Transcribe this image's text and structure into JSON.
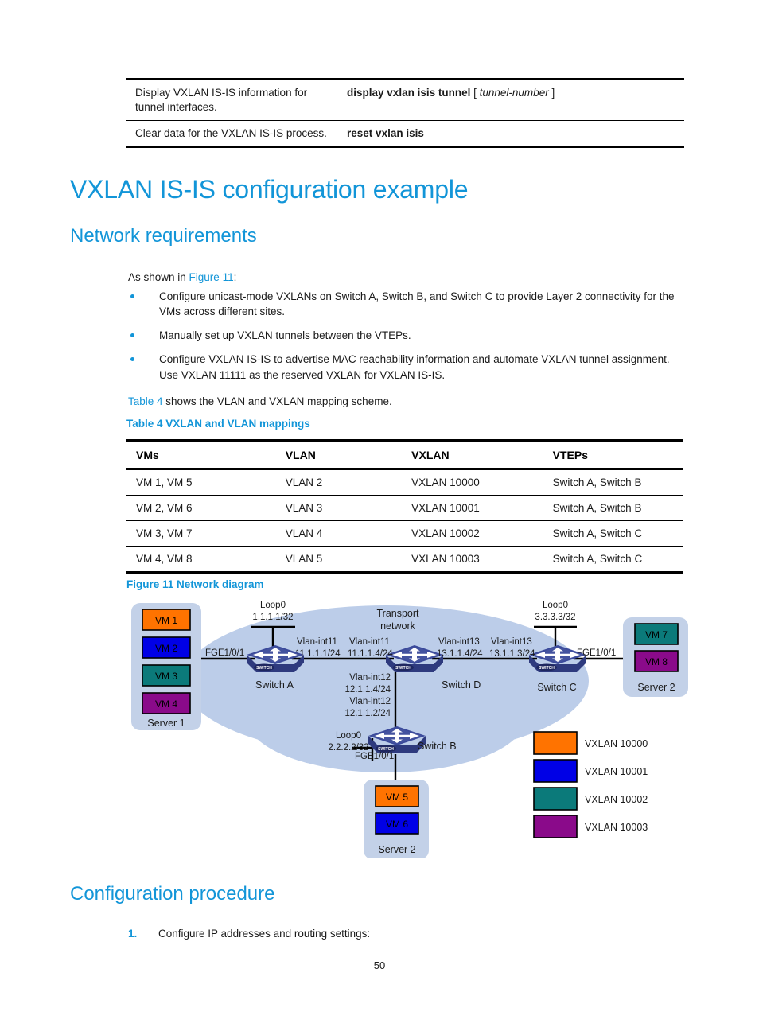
{
  "colors": {
    "heading_blue": "#1295D8",
    "link_blue": "#1295D8",
    "cloud_fill": "#BCCDE9",
    "server_fill": "#C3D1E8",
    "switch_body": "#3B4A9B",
    "switch_top": "#5A6BBF",
    "switch_side": "#2E3A7E",
    "vxlan_10000": "#FF7300",
    "vxlan_10001": "#0000E6",
    "vxlan_10002": "#0B7A7A",
    "vxlan_10003": "#8A0A8A"
  },
  "command_table": {
    "rows": [
      {
        "description": "Display VXLAN IS-IS information for tunnel interfaces.",
        "syntax_bold": "display vxlan isis tunnel",
        "syntax_optional_open": "[",
        "syntax_italic": "tunnel-number",
        "syntax_optional_close": "]"
      },
      {
        "description": "Clear data for the VXLAN IS-IS process.",
        "syntax_bold": "reset vxlan isis",
        "syntax_optional_open": "",
        "syntax_italic": "",
        "syntax_optional_close": ""
      }
    ]
  },
  "headings": {
    "h1": "VXLAN IS-IS configuration example",
    "h2_network_requirements": "Network requirements",
    "h2_configuration_procedure": "Configuration procedure"
  },
  "network_requirements": {
    "intro_prefix": "As shown in ",
    "intro_link": "Figure 11",
    "intro_suffix": ":",
    "bullets": [
      "Configure unicast-mode VXLANs on Switch A, Switch B, and Switch C to provide Layer 2 connectivity for the VMs across different sites.",
      "Manually set up VXLAN tunnels between the VTEPs.",
      "Configure VXLAN IS-IS to advertise MAC reachability information and automate VXLAN tunnel assignment. Use VXLAN 11111 as the reserved VXLAN for VXLAN IS-IS."
    ],
    "table_ref_link": "Table 4",
    "table_ref_text": " shows the VLAN and VXLAN mapping scheme."
  },
  "table4": {
    "caption": "Table 4 VXLAN and VLAN mappings",
    "headers": [
      "VMs",
      "VLAN",
      "VXLAN",
      "VTEPs"
    ],
    "rows": [
      [
        "VM 1, VM 5",
        "VLAN 2",
        "VXLAN 10000",
        "Switch A, Switch B"
      ],
      [
        "VM 2, VM 6",
        "VLAN 3",
        "VXLAN 10001",
        "Switch A, Switch B"
      ],
      [
        "VM 3, VM 7",
        "VLAN 4",
        "VXLAN 10002",
        "Switch A, Switch C"
      ],
      [
        "VM 4, VM 8",
        "VLAN 5",
        "VXLAN 10003",
        "Switch A, Switch C"
      ]
    ]
  },
  "figure11": {
    "caption": "Figure 11 Network diagram",
    "cloud_label_line1": "Transport",
    "cloud_label_line2": "network",
    "servers": [
      {
        "name": "Server 1",
        "vms": [
          {
            "label": "VM 1",
            "color": "#FF7300"
          },
          {
            "label": "VM 2",
            "color": "#0000E6"
          },
          {
            "label": "VM 3",
            "color": "#0B7A7A"
          },
          {
            "label": "VM 4",
            "color": "#8A0A8A"
          }
        ]
      },
      {
        "name": "Server 2",
        "vms": [
          {
            "label": "VM 7",
            "color": "#0B7A7A"
          },
          {
            "label": "VM 8",
            "color": "#8A0A8A"
          }
        ]
      },
      {
        "name": "Server 2",
        "vms": [
          {
            "label": "VM 5",
            "color": "#FF7300"
          },
          {
            "label": "VM 6",
            "color": "#0000E6"
          }
        ]
      }
    ],
    "switches": [
      {
        "name": "Switch A"
      },
      {
        "name": "Switch B"
      },
      {
        "name": "Switch C"
      },
      {
        "name": "Switch D"
      }
    ],
    "annotations": {
      "loop0_a_l1": "Loop0",
      "loop0_a_l2": "1.1.1.1/32",
      "loop0_b_l1": "Loop0",
      "loop0_b_l2": "2.2.2.2/32",
      "loop0_c_l1": "Loop0",
      "loop0_c_l2": "3.3.3.3/32",
      "fge_server1": "FGE1/0/1",
      "fge_server2_right": "FGE1/0/1",
      "fge_server2_bottom": "FGE1/0/1",
      "vlan_int11_a_l1": "Vlan-int11",
      "vlan_int11_a_l2": "11.1.1.1/24",
      "vlan_int11_d_l1": "Vlan-int11",
      "vlan_int11_d_l2": "11.1.1.4/24",
      "vlan_int13_d_l1": "Vlan-int13",
      "vlan_int13_d_l2": "13.1.1.4/24",
      "vlan_int13_c_l1": "Vlan-int13",
      "vlan_int13_c_l2": "13.1.1.3/24",
      "vlan_int12_d_l1": "Vlan-int12",
      "vlan_int12_d_l2": "12.1.1.4/24",
      "vlan_int12_b_l1": "Vlan-int12",
      "vlan_int12_b_l2": "12.1.1.2/24"
    },
    "legend": [
      {
        "label": "VXLAN 10000",
        "color": "#FF7300"
      },
      {
        "label": "VXLAN 10001",
        "color": "#0000E6"
      },
      {
        "label": "VXLAN 10002",
        "color": "#0B7A7A"
      },
      {
        "label": "VXLAN 10003",
        "color": "#8A0A8A"
      }
    ]
  },
  "configuration_procedure": {
    "items": [
      {
        "number": "1.",
        "text": "Configure IP addresses and routing settings:"
      }
    ]
  },
  "page_number": "50"
}
